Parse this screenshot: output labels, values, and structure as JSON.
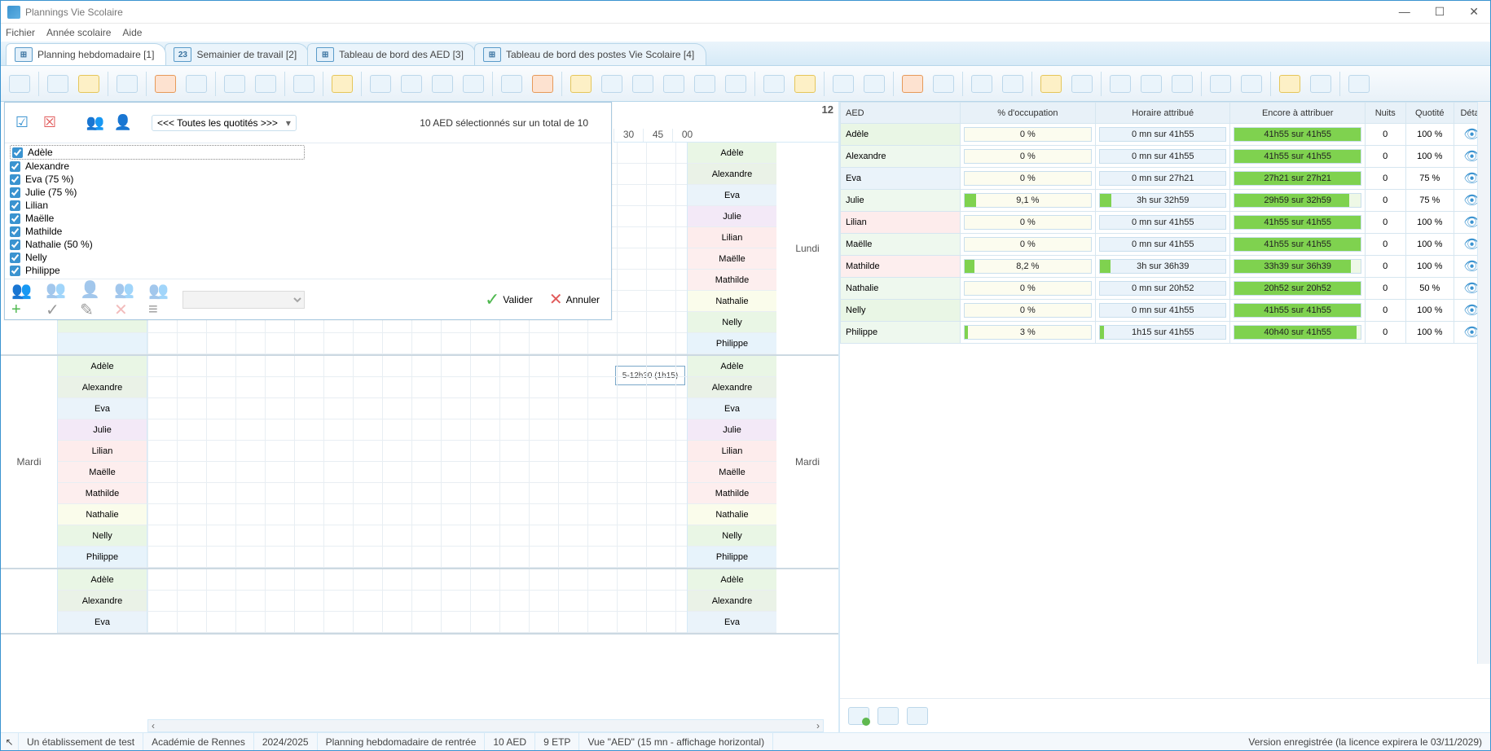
{
  "window": {
    "title": "Plannings Vie Scolaire"
  },
  "menu": {
    "file": "Fichier",
    "year": "Année scolaire",
    "help": "Aide"
  },
  "tabs": [
    {
      "icon": "⊞",
      "label": "Planning hebdomadaire [1]",
      "active": true
    },
    {
      "icon": "23",
      "label": "Semainier de travail [2]"
    },
    {
      "icon": "⊞",
      "label": "Tableau de bord des AED [3]"
    },
    {
      "icon": "⊞",
      "label": "Tableau de bord des postes Vie Scolaire [4]"
    }
  ],
  "popup": {
    "quot_label": "<<< Toutes les quotités >>>",
    "summary": "10 AED sélectionnés sur un total de 10",
    "validate": "Valider",
    "cancel": "Annuler",
    "items": [
      {
        "label": "Adèle"
      },
      {
        "label": "Alexandre"
      },
      {
        "label": "Eva (75 %)"
      },
      {
        "label": "Julie (75 %)"
      },
      {
        "label": "Lilian"
      },
      {
        "label": "Maëlle"
      },
      {
        "label": "Mathilde"
      },
      {
        "label": "Nathalie (50 %)"
      },
      {
        "label": "Nelly"
      },
      {
        "label": "Philippe"
      }
    ]
  },
  "timehdr": {
    "c0": "30",
    "c1": "45",
    "c2": "00",
    "big": "12"
  },
  "chip": "5-12h30 (1h15)",
  "days": {
    "mon": "Lundi",
    "tue": "Mardi"
  },
  "aeds": [
    {
      "name": "Adèle",
      "cls": "c-adele"
    },
    {
      "name": "Alexandre",
      "cls": "c-alex"
    },
    {
      "name": "Eva",
      "cls": "c-eva"
    },
    {
      "name": "Julie",
      "cls": "c-julie"
    },
    {
      "name": "Lilian",
      "cls": "c-lilian"
    },
    {
      "name": "Maëlle",
      "cls": "c-maelle"
    },
    {
      "name": "Mathilde",
      "cls": "c-mathilde"
    },
    {
      "name": "Nathalie",
      "cls": "c-nathalie"
    },
    {
      "name": "Nelly",
      "cls": "c-nelly"
    },
    {
      "name": "Philippe",
      "cls": "c-philippe"
    }
  ],
  "partialDay3Count": 3,
  "rheaders": {
    "aed": "AED",
    "occ": "% d'occupation",
    "hor": "Horaire attribué",
    "enc": "Encore à attribuer",
    "nuits": "Nuits",
    "quot": "Quotité",
    "det": "Détail"
  },
  "rrows": [
    {
      "name": "Adèle",
      "cls": "c-adele",
      "occ": "0 %",
      "occp": 0,
      "hor": "0 mn sur 41h55",
      "enc": "41h55 sur 41h55",
      "encp": 100,
      "nuits": "0",
      "quot": "100 %"
    },
    {
      "name": "Alexandre",
      "cls": "c-alex",
      "occ": "0 %",
      "occp": 0,
      "hor": "0 mn sur 41h55",
      "enc": "41h55 sur 41h55",
      "encp": 100,
      "nuits": "0",
      "quot": "100 %"
    },
    {
      "name": "Eva",
      "cls": "c-eva",
      "occ": "0 %",
      "occp": 0,
      "hor": "0 mn sur 27h21",
      "enc": "27h21 sur 27h21",
      "encp": 100,
      "nuits": "0",
      "quot": "75 %"
    },
    {
      "name": "Julie",
      "cls": "c-julie",
      "occ": "9,1 %",
      "occp": 9.1,
      "hor": "3h sur 32h59",
      "enc": "29h59 sur 32h59",
      "encp": 91,
      "nuits": "0",
      "quot": "75 %"
    },
    {
      "name": "Lilian",
      "cls": "c-lilian",
      "occ": "0 %",
      "occp": 0,
      "hor": "0 mn sur 41h55",
      "enc": "41h55 sur 41h55",
      "encp": 100,
      "nuits": "0",
      "quot": "100 %"
    },
    {
      "name": "Maëlle",
      "cls": "c-maelle",
      "occ": "0 %",
      "occp": 0,
      "hor": "0 mn sur 41h55",
      "enc": "41h55 sur 41h55",
      "encp": 100,
      "nuits": "0",
      "quot": "100 %"
    },
    {
      "name": "Mathilde",
      "cls": "c-mathilde",
      "occ": "8,2 %",
      "occp": 8.2,
      "hor": "3h sur 36h39",
      "enc": "33h39 sur 36h39",
      "encp": 92,
      "nuits": "0",
      "quot": "100 %"
    },
    {
      "name": "Nathalie",
      "cls": "c-nathalie",
      "occ": "0 %",
      "occp": 0,
      "hor": "0 mn sur 20h52",
      "enc": "20h52 sur 20h52",
      "encp": 100,
      "nuits": "0",
      "quot": "50 %"
    },
    {
      "name": "Nelly",
      "cls": "c-nelly",
      "occ": "0 %",
      "occp": 0,
      "hor": "0 mn sur 41h55",
      "enc": "41h55 sur 41h55",
      "encp": 100,
      "nuits": "0",
      "quot": "100 %"
    },
    {
      "name": "Philippe",
      "cls": "c-philippe",
      "occ": "3 %",
      "occp": 3,
      "hor": "1h15 sur 41h55",
      "enc": "40h40 sur 41h55",
      "encp": 97,
      "nuits": "0",
      "quot": "100 %"
    }
  ],
  "status": {
    "etab": "Un établissement de test",
    "acad": "Académie de Rennes",
    "year": "2024/2025",
    "plan": "Planning hebdomadaire de rentrée",
    "aed": "10 AED",
    "etp": "9 ETP",
    "view": "Vue \"AED\" (15 mn - affichage horizontal)",
    "lic": "Version enregistrée (la licence expirera le 03/11/2029)"
  }
}
